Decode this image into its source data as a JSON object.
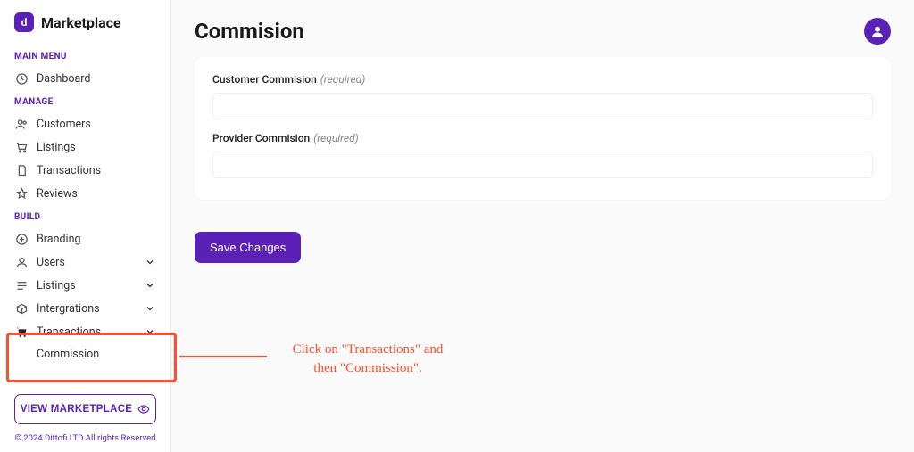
{
  "brand": {
    "name": "Marketplace",
    "logo_letter": "d"
  },
  "sidebar": {
    "section_main": "MAIN MENU",
    "dashboard": "Dashboard",
    "section_manage": "MANAGE",
    "customers": "Customers",
    "listings_m": "Listings",
    "transactions_m": "Transactions",
    "reviews": "Reviews",
    "section_build": "BUILD",
    "branding": "Branding",
    "users": "Users",
    "listings_b": "Listings",
    "integrations": "Intergrations",
    "transactions_b": "Transactions",
    "commission_sub": "Commission",
    "view_marketplace": "VIEW MARKETPLACE",
    "copyright": "© 2024 Dittofi LTD All rights Reserved"
  },
  "page": {
    "title": "Commision",
    "customer_label": "Customer Commision",
    "provider_label": "Provider Commision",
    "required": "(required)",
    "save": "Save Changes",
    "customer_value": "",
    "provider_value": ""
  },
  "annotation": {
    "line1": "Click on \"Transactions\" and",
    "line2": "then \"Commission\"."
  },
  "colors": {
    "accent": "#5b21b6",
    "highlight": "#ff4d2d"
  }
}
